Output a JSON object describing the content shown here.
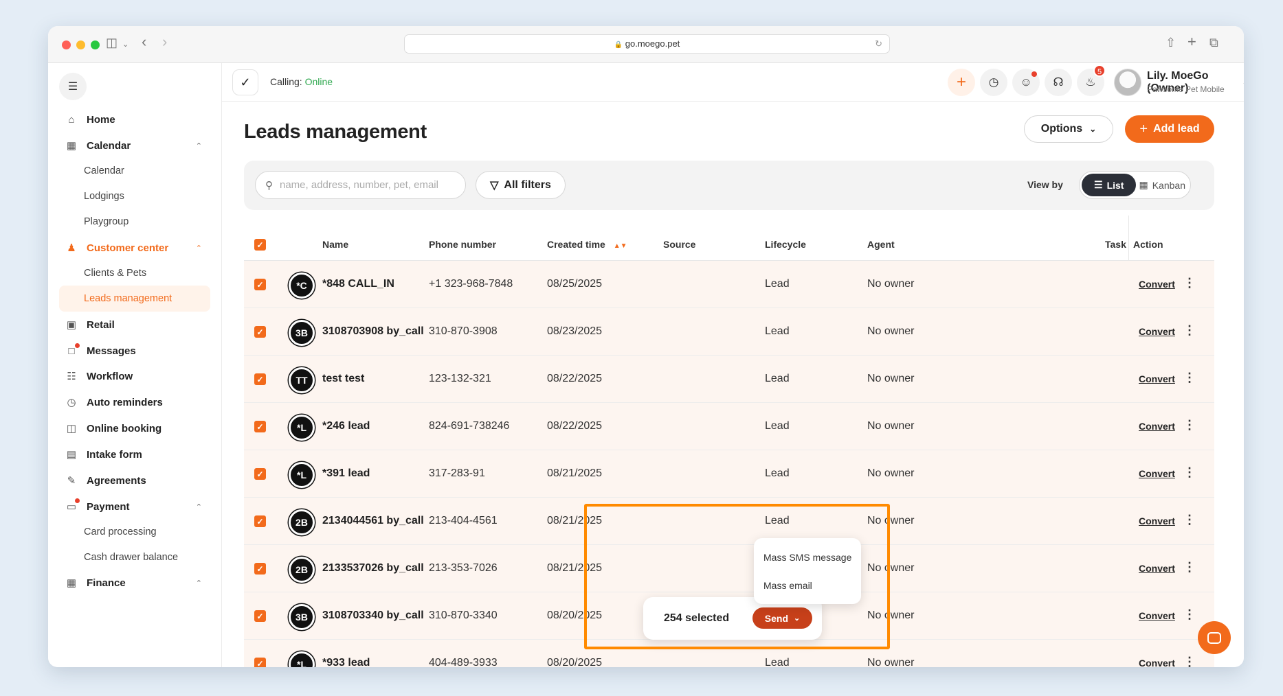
{
  "browser": {
    "url": "go.moego.pet"
  },
  "sidebar": {
    "items": [
      {
        "label": "Home",
        "icon": "home-icon"
      },
      {
        "label": "Calendar",
        "icon": "calendar-icon"
      },
      {
        "label": "Calendar"
      },
      {
        "label": "Lodgings"
      },
      {
        "label": "Playgroup"
      },
      {
        "label": "Customer center",
        "icon": "users-icon"
      },
      {
        "label": "Clients & Pets"
      },
      {
        "label": "Leads management"
      },
      {
        "label": "Retail",
        "icon": "retail-icon"
      },
      {
        "label": "Messages",
        "icon": "messages-icon"
      },
      {
        "label": "Workflow",
        "icon": "workflow-icon"
      },
      {
        "label": "Auto reminders",
        "icon": "alarm-icon"
      },
      {
        "label": "Online booking",
        "icon": "online-booking-icon"
      },
      {
        "label": "Intake form",
        "icon": "clipboard-icon"
      },
      {
        "label": "Agreements",
        "icon": "pen-icon"
      },
      {
        "label": "Payment",
        "icon": "payment-icon"
      },
      {
        "label": "Card processing"
      },
      {
        "label": "Cash drawer balance"
      },
      {
        "label": "Finance",
        "icon": "finance-icon"
      }
    ]
  },
  "topbar": {
    "calling_label": "Calling:",
    "calling_status": "Online",
    "notification_count": "5",
    "user_name": "Lily. MoeGo (Owner)",
    "user_business": "Pawsome Pet Mobile"
  },
  "page": {
    "title": "Leads management",
    "options_label": "Options",
    "add_lead_label": "Add lead",
    "search_placeholder": "name, address, number, pet, email",
    "all_filters_label": "All filters",
    "view_by_label": "View by",
    "view_list_label": "List",
    "view_kanban_label": "Kanban"
  },
  "table": {
    "columns": [
      "Name",
      "Phone number",
      "Created time",
      "Source",
      "Lifecycle",
      "Agent",
      "Task",
      "Action"
    ],
    "rows": [
      {
        "initials": "*C",
        "name": "*848 CALL_IN",
        "phone": "+1 323-968-7848",
        "created": "08/25/2025",
        "source": "",
        "lifecycle": "Lead",
        "agent": "No owner",
        "action": "Convert"
      },
      {
        "initials": "3B",
        "name": "3108703908 by_call",
        "phone": "310-870-3908",
        "created": "08/23/2025",
        "source": "",
        "lifecycle": "Lead",
        "agent": "No owner",
        "action": "Convert"
      },
      {
        "initials": "TT",
        "name": "test test",
        "phone": "123-132-321",
        "created": "08/22/2025",
        "source": "",
        "lifecycle": "Lead",
        "agent": "No owner",
        "action": "Convert"
      },
      {
        "initials": "*L",
        "name": "*246 lead",
        "phone": "824-691-738246",
        "created": "08/22/2025",
        "source": "",
        "lifecycle": "Lead",
        "agent": "No owner",
        "action": "Convert"
      },
      {
        "initials": "*L",
        "name": "*391 lead",
        "phone": "317-283-91",
        "created": "08/21/2025",
        "source": "",
        "lifecycle": "Lead",
        "agent": "No owner",
        "action": "Convert"
      },
      {
        "initials": "2B",
        "name": "2134044561 by_call",
        "phone": "213-404-4561",
        "created": "08/21/2025",
        "source": "",
        "lifecycle": "Lead",
        "agent": "No owner",
        "action": "Convert"
      },
      {
        "initials": "2B",
        "name": "2133537026 by_call",
        "phone": "213-353-7026",
        "created": "08/21/2025",
        "source": "",
        "lifecycle": "Lead",
        "agent": "No owner",
        "action": "Convert"
      },
      {
        "initials": "3B",
        "name": "3108703340 by_call",
        "phone": "310-870-3340",
        "created": "08/20/2025",
        "source": "",
        "lifecycle": "Lead",
        "agent": "No owner",
        "action": "Convert"
      },
      {
        "initials": "*L",
        "name": "*933 lead",
        "phone": "404-489-3933",
        "created": "08/20/2025",
        "source": "",
        "lifecycle": "Lead",
        "agent": "No owner",
        "action": "Convert"
      }
    ]
  },
  "selection": {
    "count_label": "254 selected",
    "send_label": "Send",
    "send_menu": [
      "Mass SMS message",
      "Mass email"
    ]
  },
  "colors": {
    "accent": "#f26a1b",
    "send_button": "#c7401a",
    "highlight_box": "#ff8a00",
    "online": "#2fa84f"
  }
}
